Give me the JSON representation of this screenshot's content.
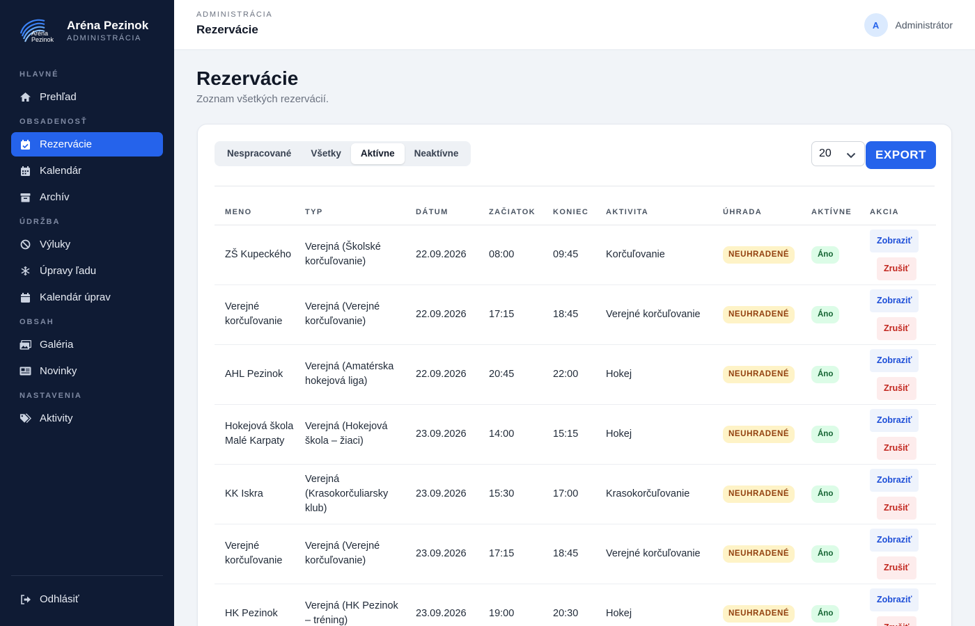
{
  "brand": {
    "logo_line1": "Aréna",
    "logo_line2": "Pezinok",
    "title": "Aréna Pezinok",
    "subtitle": "ADMINISTRÁCIA"
  },
  "sidebar": {
    "sections": {
      "main": "HLAVNÉ",
      "occupancy": "OBSADENOSŤ",
      "maintenance": "ÚDRŽBA",
      "content": "OBSAH",
      "settings": "NASTAVENIA"
    },
    "items": {
      "overview": "Prehľad",
      "reservations": "Rezervácie",
      "calendar": "Kalendár",
      "archive": "Archív",
      "outages": "Výluky",
      "ice": "Úpravy ľadu",
      "maint_calendar": "Kalendár úprav",
      "gallery": "Galéria",
      "news": "Novinky",
      "activities": "Aktivity"
    },
    "logout": "Odhlásiť",
    "active_item": "reservations"
  },
  "topbar": {
    "crumb": "ADMINISTRÁCIA",
    "title": "Rezervácie",
    "avatar_letter": "A",
    "user_name": "Administrátor"
  },
  "page": {
    "title": "Rezervácie",
    "subtitle": "Zoznam všetkých rezervácií."
  },
  "tabs": [
    "Nespracované",
    "Všetky",
    "Aktívne",
    "Neaktívne"
  ],
  "active_tab": "Aktívne",
  "toolbar": {
    "per_page": "20",
    "export_label": "EXPORT"
  },
  "table": {
    "headers": [
      "MENO",
      "TYP",
      "DÁTUM",
      "ZAČIATOK",
      "KONIEC",
      "AKTIVITA",
      "ÚHRADA",
      "AKTÍVNE",
      "AKCIA"
    ],
    "view_label": "Zobraziť",
    "cancel_label": "Zrušiť",
    "rows": [
      {
        "name": "ZŠ Kupeckého",
        "type": "Verejná (Školské korčuľovanie)",
        "date": "22.09.2026",
        "start": "08:00",
        "end": "09:45",
        "activity": "Korčuľovanie",
        "payment": "NEUHRADENÉ",
        "active": "Áno"
      },
      {
        "name": "Verejné korčuľovanie",
        "type": "Verejná (Verejné korčuľovanie)",
        "date": "22.09.2026",
        "start": "17:15",
        "end": "18:45",
        "activity": "Verejné korčuľovanie",
        "payment": "NEUHRADENÉ",
        "active": "Áno"
      },
      {
        "name": "AHL Pezinok",
        "type": "Verejná (Amatérska hokejová liga)",
        "date": "22.09.2026",
        "start": "20:45",
        "end": "22:00",
        "activity": "Hokej",
        "payment": "NEUHRADENÉ",
        "active": "Áno"
      },
      {
        "name": "Hokejová škola Malé Karpaty",
        "type": "Verejná (Hokejová škola – žiaci)",
        "date": "23.09.2026",
        "start": "14:00",
        "end": "15:15",
        "activity": "Hokej",
        "payment": "NEUHRADENÉ",
        "active": "Áno"
      },
      {
        "name": "KK Iskra",
        "type": "Verejná (Krasokorčuliarsky klub)",
        "date": "23.09.2026",
        "start": "15:30",
        "end": "17:00",
        "activity": "Krasokorčuľovanie",
        "payment": "NEUHRADENÉ",
        "active": "Áno"
      },
      {
        "name": "Verejné korčuľovanie",
        "type": "Verejná (Verejné korčuľovanie)",
        "date": "23.09.2026",
        "start": "17:15",
        "end": "18:45",
        "activity": "Verejné korčuľovanie",
        "payment": "NEUHRADENÉ",
        "active": "Áno"
      },
      {
        "name": "HK Pezinok",
        "type": "Verejná (HK Pezinok – tréning)",
        "date": "23.09.2026",
        "start": "19:00",
        "end": "20:30",
        "activity": "Hokej",
        "payment": "NEUHRADENÉ",
        "active": "Áno"
      }
    ]
  },
  "colors": {
    "sidebar_bg": "#0f1b34",
    "accent": "#2563eb",
    "unpaid_bg": "#fef3c7",
    "active_bg": "#dcfce7"
  }
}
